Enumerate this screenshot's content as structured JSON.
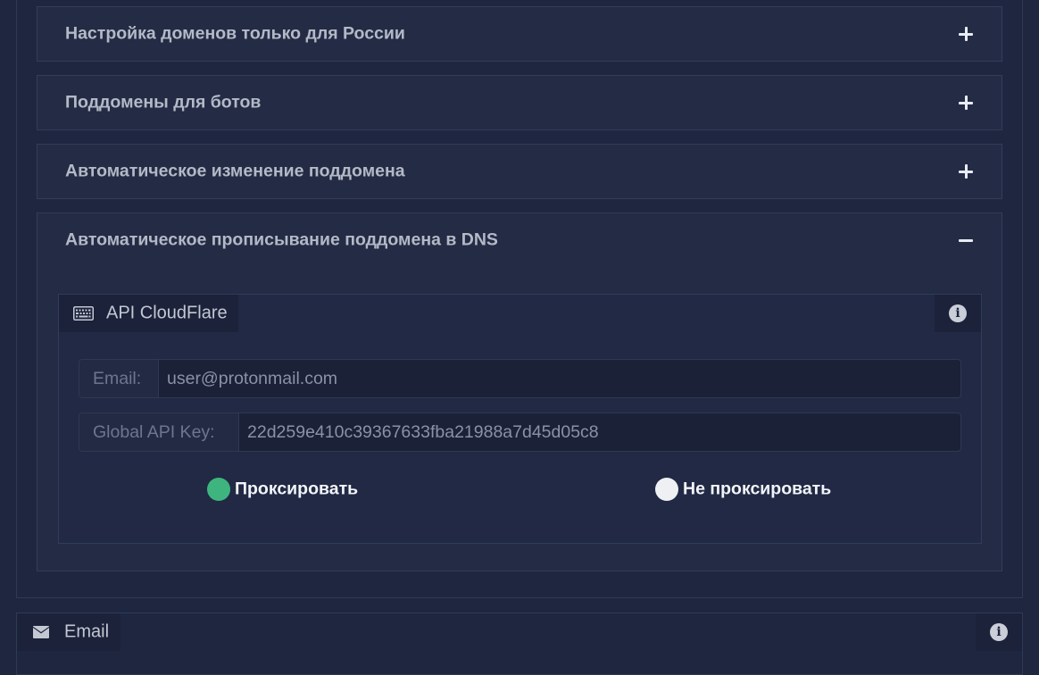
{
  "accordion": {
    "items": [
      {
        "title": "Настройка доменов только для России",
        "state": "collapsed"
      },
      {
        "title": "Поддомены для ботов",
        "state": "collapsed"
      },
      {
        "title": "Автоматическое изменение поддомена",
        "state": "collapsed"
      },
      {
        "title": "Автоматическое прописывание поддомена в DNS",
        "state": "expanded"
      }
    ]
  },
  "api_cloudflare": {
    "tab_label": "API CloudFlare",
    "tab_icon": "keyboard-icon",
    "info_icon": "info-circle-icon",
    "email": {
      "label": "Email:",
      "value": "user@protonmail.com"
    },
    "global_api_key": {
      "label": "Global API Key:",
      "value": "22d259e410c39367633fba21988a7d45d05c8"
    },
    "proxy_options": [
      {
        "label": "Проксировать",
        "selected": true,
        "color": "#3eb57f"
      },
      {
        "label": "Не проксировать",
        "selected": false,
        "color": "#eef0f4"
      }
    ]
  },
  "email_panel": {
    "tab_label": "Email",
    "tab_icon": "envelope-icon",
    "info_icon": "info-circle-icon"
  },
  "colors": {
    "background": "#1e2640",
    "panel": "#232b45",
    "accent_green": "#3eb57f"
  }
}
